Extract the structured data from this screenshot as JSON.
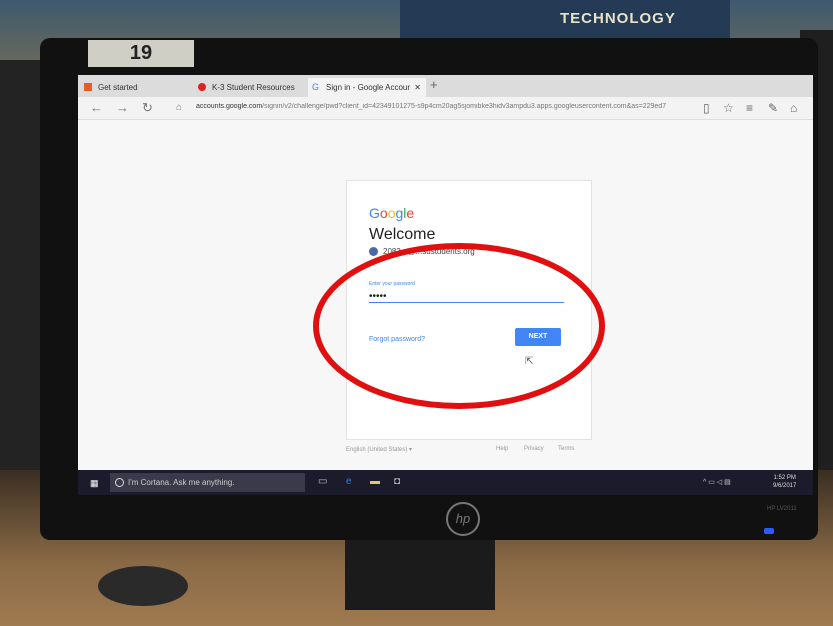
{
  "poster": {
    "text": "TECHNOLOGY"
  },
  "monitor": {
    "sticker_number": "19",
    "brand": "hp",
    "model": "HP LV2011"
  },
  "browser": {
    "tabs": [
      {
        "label": "Get started",
        "active": false
      },
      {
        "label": "K-3 Student Resources",
        "active": false
      },
      {
        "label": "Sign in - Google Accour",
        "active": true
      }
    ],
    "url_host": "accounts.google.com",
    "url_rest": "/signin/v2/challenge/pwd?client_id=42349101275-s9p4cm20ag5sjomibke3hidv3ampdu3.apps.googleusercontent.com&as=229ed7"
  },
  "signin": {
    "logo": [
      "G",
      "o",
      "o",
      "g",
      "l",
      "e"
    ],
    "heading": "Welcome",
    "account": "2083...@...sdstudents.org",
    "password_label": "Enter your password",
    "password_value": "•••••",
    "forgot_link": "Forgot password?",
    "next_button": "NEXT"
  },
  "footer": {
    "language": "English (United States)",
    "help": "Help",
    "privacy": "Privacy",
    "terms": "Terms"
  },
  "taskbar": {
    "cortana_placeholder": "I'm Cortana. Ask me anything.",
    "time": "1:52 PM",
    "date": "9/6/2017"
  },
  "colors": {
    "google_blue": "#4285f4",
    "annotation_red": "#e01010"
  }
}
